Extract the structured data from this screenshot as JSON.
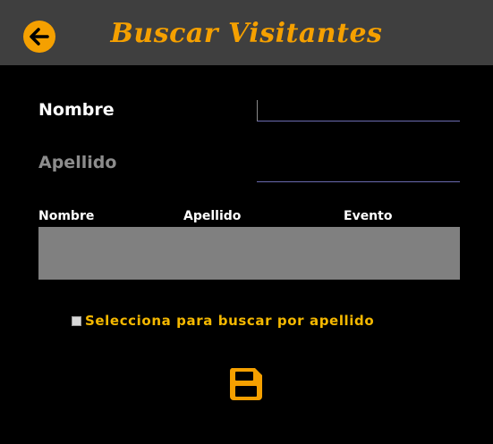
{
  "header": {
    "title": "Buscar Visitantes",
    "back_icon": "arrow-left-circle-icon"
  },
  "form": {
    "nombre_label": "Nombre",
    "nombre_value": "",
    "apellido_label": "Apellido",
    "apellido_value": ""
  },
  "table": {
    "columns": [
      "Nombre",
      "Apellido",
      "Evento"
    ],
    "rows": []
  },
  "options": {
    "search_by_apellido_label": "Selecciona para buscar por apellido",
    "search_by_apellido_checked": false
  },
  "actions": {
    "save_icon": "save-floppy-icon"
  },
  "colors": {
    "accent": "#f5a000",
    "checkbox_label": "#f5b800",
    "header_bg": "#3f3f3f",
    "background": "#000000",
    "grid_bg": "#808080"
  }
}
